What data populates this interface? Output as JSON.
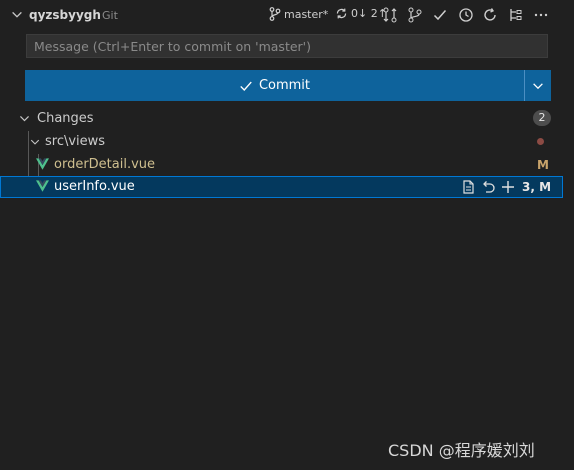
{
  "header": {
    "repo_name": "qyzsbyygh",
    "repo_provider": "Git",
    "branch": "master*",
    "sync": "0↓ 2↑"
  },
  "commit": {
    "message_placeholder": "Message (Ctrl+Enter to commit on 'master')",
    "button_label": "Commit"
  },
  "changes": {
    "label": "Changes",
    "count": "2",
    "folder": "src\\views",
    "files": [
      {
        "name": "orderDetail.vue",
        "status": "M"
      },
      {
        "name": "userInfo.vue",
        "status": "3, M"
      }
    ]
  },
  "colors": {
    "accent": "#0e639c",
    "selection": "#04395e",
    "vue_green": "#4fc08d",
    "modified": "#c8a36a"
  },
  "watermark": "CSDN @程序媛刘刘"
}
